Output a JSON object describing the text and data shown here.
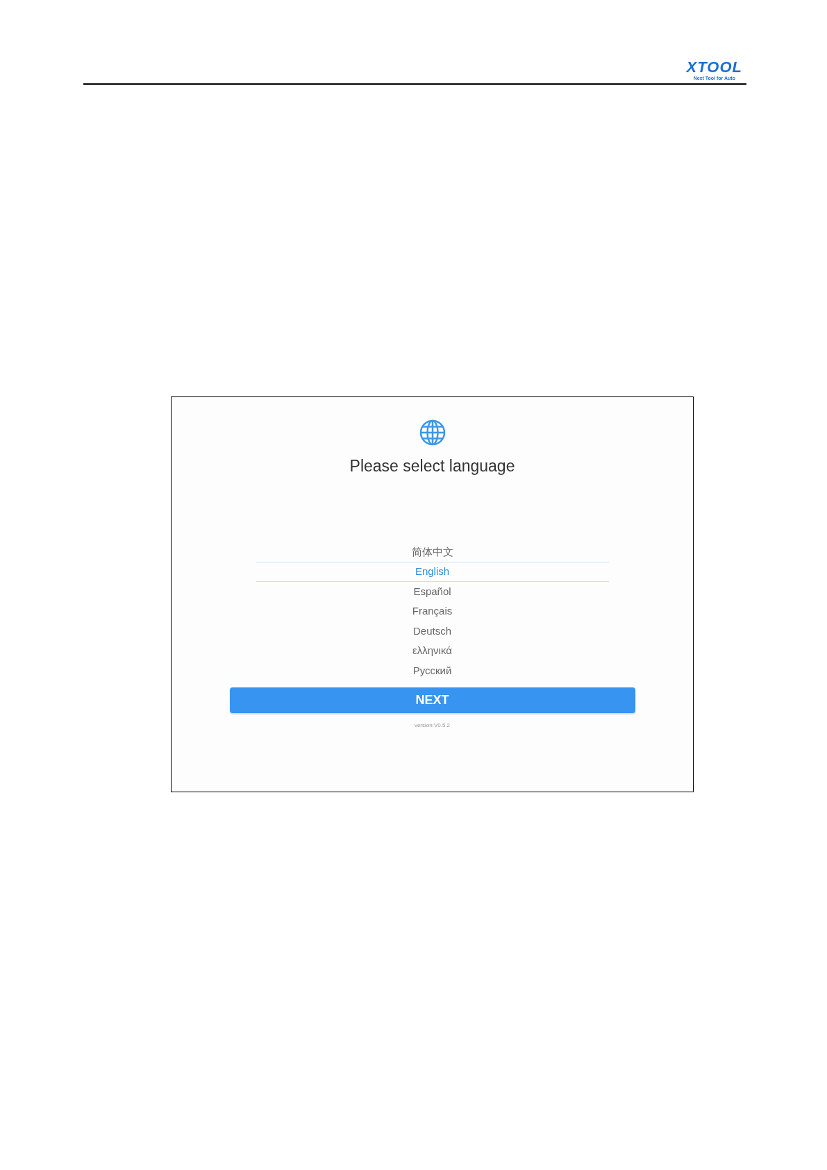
{
  "header": {
    "logo": "XTOOL",
    "tagline": "Next Tool for Auto"
  },
  "screen": {
    "title": "Please select language",
    "languages": [
      {
        "label": "简体中文",
        "selected": false
      },
      {
        "label": "English",
        "selected": true
      },
      {
        "label": "Español",
        "selected": false
      },
      {
        "label": "Français",
        "selected": false
      },
      {
        "label": "Deutsch",
        "selected": false
      },
      {
        "label": "ελληνικά",
        "selected": false
      },
      {
        "label": "Русский",
        "selected": false
      }
    ],
    "button": "NEXT",
    "version": "version:V0.5.2"
  }
}
